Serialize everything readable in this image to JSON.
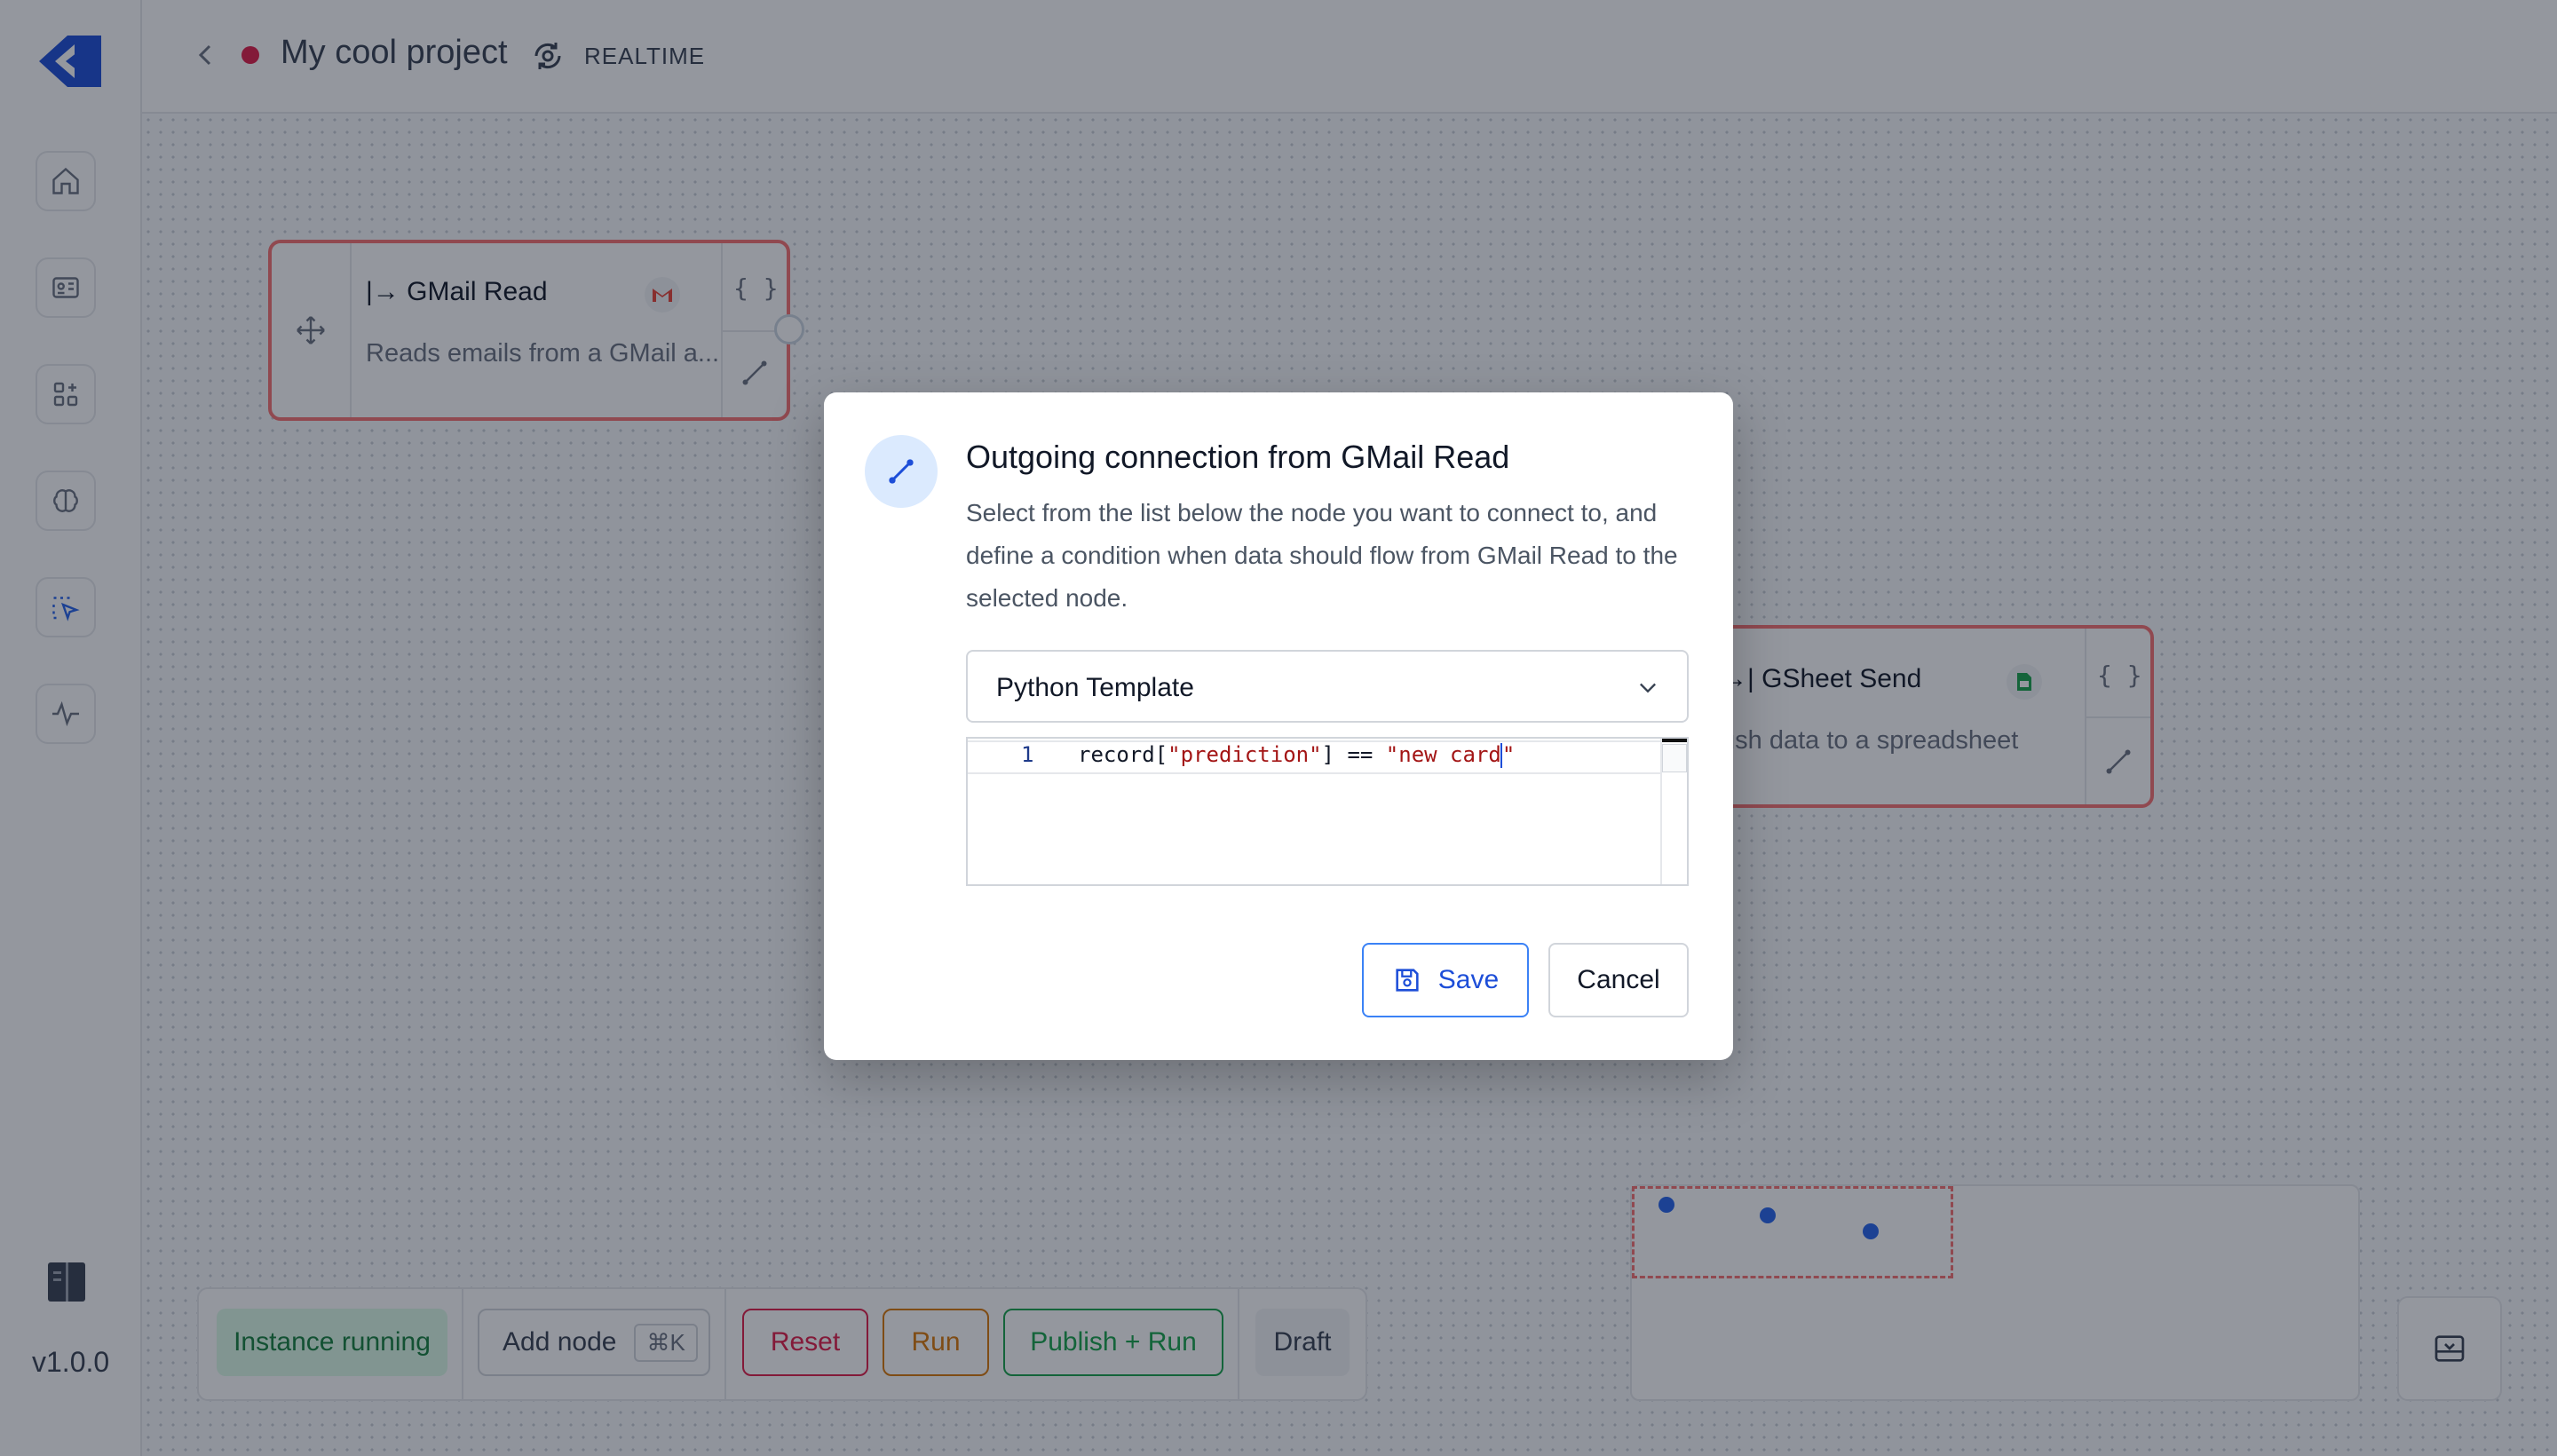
{
  "app": {
    "version": "v1.0.0",
    "project_name": "My cool project",
    "mode_label": "REALTIME"
  },
  "sidebar": {
    "items": [
      {
        "name": "home"
      },
      {
        "name": "instances"
      },
      {
        "name": "apps"
      },
      {
        "name": "models"
      },
      {
        "name": "pipelines",
        "active": true
      },
      {
        "name": "monitoring"
      }
    ]
  },
  "nodes": {
    "gmail": {
      "title": "GMail Read",
      "direction_glyph": "|→",
      "description": "Reads emails from a GMail a..."
    },
    "gsheet": {
      "title": "GSheet Send",
      "direction_glyph": "→|",
      "description": "ush data to a spreadsheet"
    }
  },
  "toolbar": {
    "status": "Instance running",
    "add_node": "Add node",
    "add_node_shortcut": "⌘K",
    "reset": "Reset",
    "run": "Run",
    "publish_run": "Publish + Run",
    "draft": "Draft"
  },
  "colors": {
    "accent": "#2563eb",
    "danger": "#e11d48",
    "warning": "#d97706",
    "success": "#16a34a"
  },
  "modal": {
    "title": "Outgoing connection from GMail Read",
    "description": "Select from the list below the node you want to connect to, and define a condition when data should flow from GMail Read to the selected node.",
    "select_value": "Python Template",
    "editor": {
      "line_number": "1",
      "code_prefix": "record[",
      "code_str1": "\"prediction\"",
      "code_mid": "] == ",
      "code_str2": "\"new card",
      "code_str3": "\""
    },
    "save_label": "Save",
    "cancel_label": "Cancel"
  }
}
